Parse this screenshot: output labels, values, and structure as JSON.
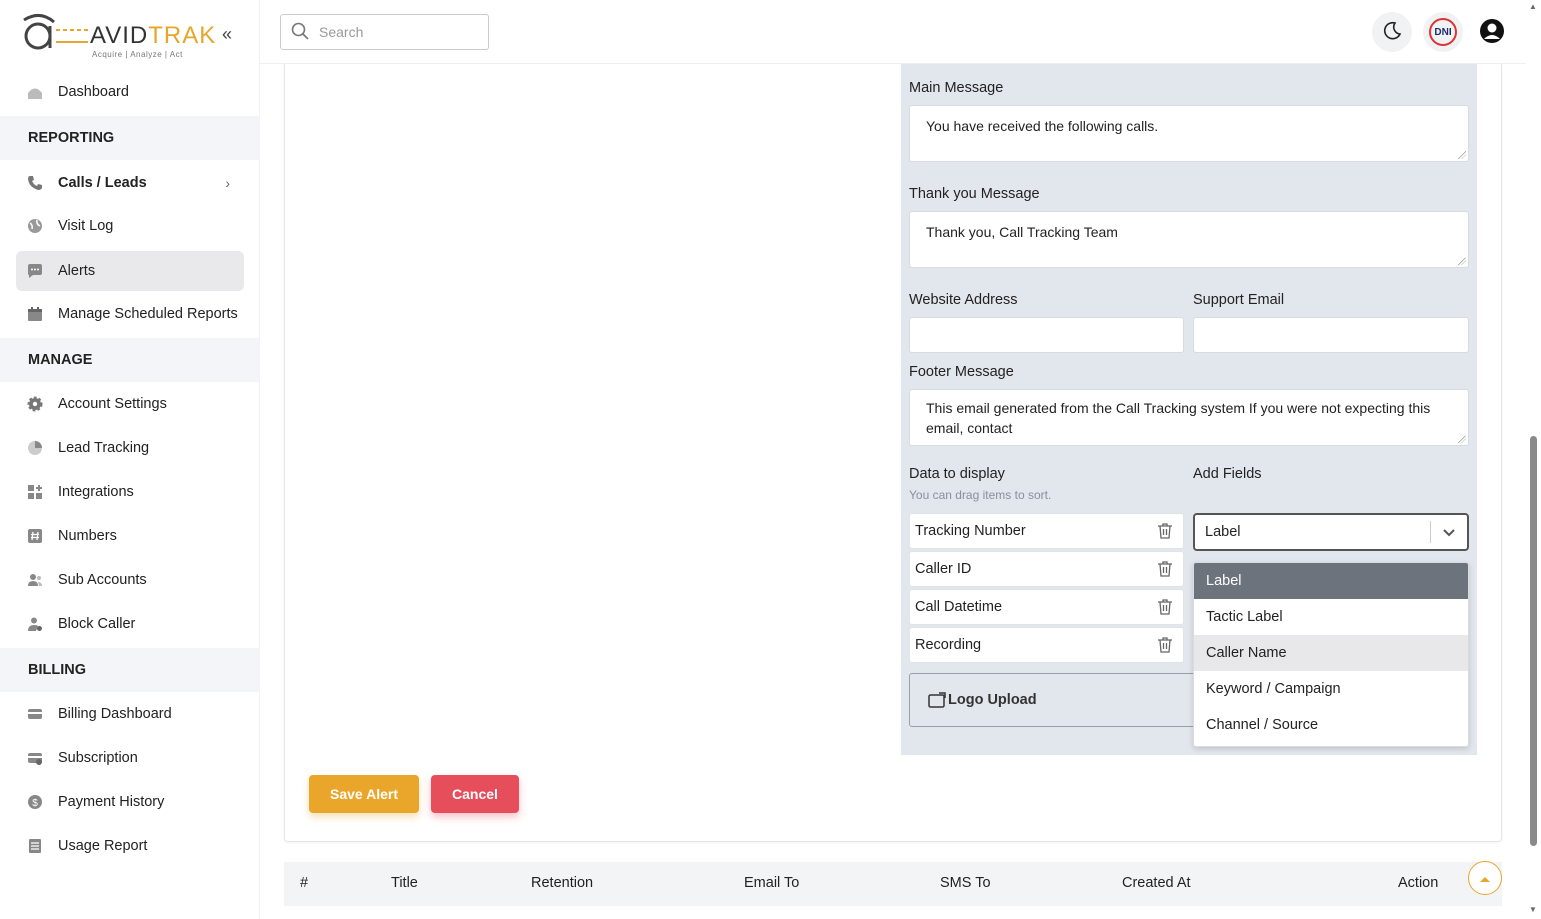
{
  "brand": {
    "name_prefix": "AVID",
    "name_suffix": "TRAK",
    "tagline": "Acquire  |  Analyze  |  Act",
    "accent_color": "#e6a52b"
  },
  "sidebar": {
    "dashboard": "Dashboard",
    "sections": {
      "reporting": "REPORTING",
      "manage": "MANAGE",
      "billing": "BILLING"
    },
    "reporting_items": [
      "Calls / Leads",
      "Visit Log",
      "Alerts",
      "Manage Scheduled Reports"
    ],
    "manage_items": [
      "Account Settings",
      "Lead Tracking",
      "Integrations",
      "Numbers",
      "Sub Accounts",
      "Block Caller"
    ],
    "billing_items": [
      "Billing Dashboard",
      "Subscription",
      "Payment History",
      "Usage Report"
    ],
    "active_item": "Alerts"
  },
  "topbar": {
    "search_placeholder": "Search",
    "dni_label": "DNI"
  },
  "form": {
    "main_message_label": "Main Message",
    "main_message_value": "You have received the following calls.",
    "thank_you_label": "Thank you Message",
    "thank_you_value": "Thank you, Call Tracking Team",
    "website_label": "Website Address",
    "website_value": "",
    "support_email_label": "Support Email",
    "support_email_value": "",
    "footer_label": "Footer Message",
    "footer_value": "This email generated from the Call Tracking system If you were not expecting this email, contact",
    "data_display_label": "Data to display",
    "data_display_hint": "You can drag items to sort.",
    "data_fields": [
      "Tracking Number",
      "Caller ID",
      "Call Datetime",
      "Recording"
    ],
    "add_fields_label": "Add Fields",
    "add_fields_selected": "Label",
    "add_fields_options": [
      "Label",
      "Tactic Label",
      "Caller Name",
      "Keyword / Campaign",
      "Channel / Source"
    ],
    "logo_upload_label": "Logo Upload"
  },
  "actions": {
    "save_label": "Save Alert",
    "cancel_label": "Cancel"
  },
  "table": {
    "headers": [
      "#",
      "Title",
      "Retention",
      "Email To",
      "SMS To",
      "Created At",
      "Action"
    ]
  }
}
